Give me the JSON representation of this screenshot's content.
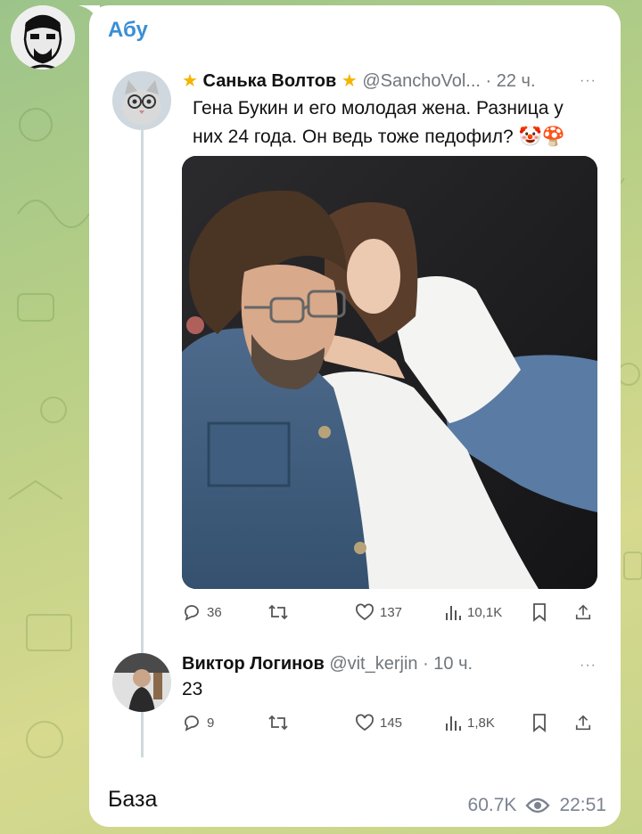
{
  "message": {
    "sender": "Абу",
    "caption": "База",
    "views": "60.7K",
    "time": "22:51"
  },
  "tweet1": {
    "name": "Санька Волтов",
    "handle": "@SanchoVol...",
    "age": "· 22 ч.",
    "text": "Гена Букин и его молодая жена. Разница у них 24 года. Он ведь тоже педофил? 🤡🍄",
    "replies": "36",
    "likes": "137",
    "views": "10,1K"
  },
  "tweet2": {
    "name": "Виктор Логинов",
    "handle": "@vit_kerjin",
    "age": "· 10 ч.",
    "text": "23",
    "replies": "9",
    "likes": "145",
    "views": "1,8K"
  },
  "more_label": "···"
}
